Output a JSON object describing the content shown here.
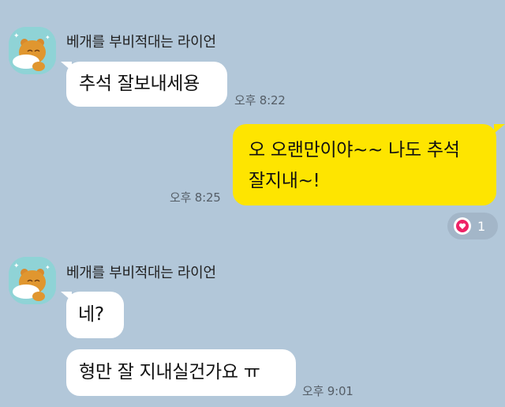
{
  "chat": {
    "messages": [
      {
        "sender": "베개를 부비적대는 라이언",
        "text": "추석 잘보내세용",
        "time": "오후 8:22"
      },
      {
        "text_line1": "오 오랜만이야~~ 나도 추석",
        "text_line2": "잘지내~!",
        "time": "오후 8:25",
        "reaction": {
          "icon": "heart-icon",
          "count": "1"
        }
      },
      {
        "sender": "베개를 부비적대는 라이언",
        "text1": "네?",
        "text2": "형만 잘 지내실건가요 ㅠ",
        "time": "오후 9:01"
      }
    ]
  },
  "colors": {
    "background": "#b2c7d9",
    "incoming_bubble": "#ffffff",
    "outgoing_bubble": "#fee500",
    "reaction_heart": "#ee2266"
  }
}
